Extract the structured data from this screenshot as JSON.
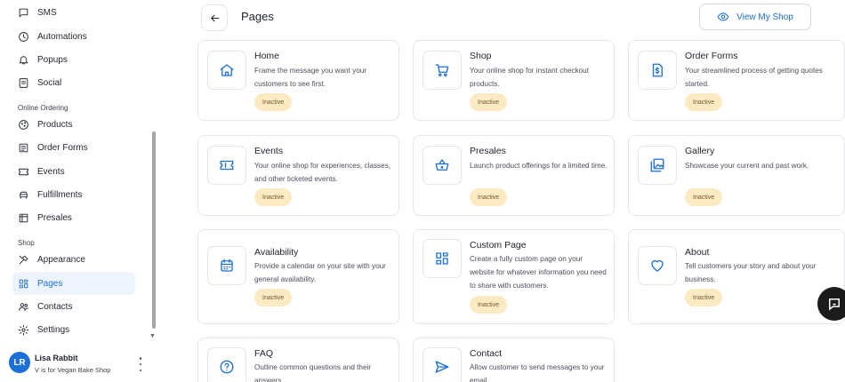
{
  "sidebar": {
    "items": [
      {
        "label": "SMS",
        "icon": "message-icon"
      },
      {
        "label": "Automations",
        "icon": "automation-icon"
      },
      {
        "label": "Popups",
        "icon": "bell-icon"
      },
      {
        "label": "Social",
        "icon": "social-icon"
      },
      {
        "label": "Products",
        "icon": "cookie-icon"
      },
      {
        "label": "Order Forms",
        "icon": "order-forms-icon"
      },
      {
        "label": "Events",
        "icon": "ticket-icon"
      },
      {
        "label": "Fulfillments",
        "icon": "car-icon"
      },
      {
        "label": "Presales",
        "icon": "presales-icon"
      },
      {
        "label": "Appearance",
        "icon": "tools-icon"
      },
      {
        "label": "Pages",
        "icon": "grid-icon"
      },
      {
        "label": "Contacts",
        "icon": "contacts-icon"
      },
      {
        "label": "Settings",
        "icon": "gear-icon"
      }
    ],
    "sections": {
      "online_ordering": "Online Ordering",
      "shop": "Shop"
    },
    "active_item": "Pages"
  },
  "user": {
    "initials": "LR",
    "name": "Lisa Rabbit",
    "shop": "V is for Vegan Bake Shop"
  },
  "header": {
    "title": "Pages",
    "view_shop_label": "View My Shop"
  },
  "cards": [
    {
      "title": "Home",
      "description": "Frame the message you want your customers to see first.",
      "status": "Inactive",
      "icon": "home-icon"
    },
    {
      "title": "Shop",
      "description": "Your online shop for instant checkout products.",
      "status": "Inactive",
      "icon": "cart-icon"
    },
    {
      "title": "Order Forms",
      "description": "Your streamlined process of getting quotes started.",
      "status": "Inactive",
      "icon": "document-dollar-icon"
    },
    {
      "title": "Events",
      "description": "Your online shop for experiences, classes, and other ticketed events.",
      "status": "Inactive",
      "icon": "ticket-icon"
    },
    {
      "title": "Presales",
      "description": "Launch product offerings for a limited time.",
      "status": "Inactive",
      "icon": "basket-icon"
    },
    {
      "title": "Gallery",
      "description": "Showcase your current and past work.",
      "status": "Inactive",
      "icon": "gallery-icon"
    },
    {
      "title": "Availability",
      "description": "Provide a calendar on your site with your general availability.",
      "status": "Inactive",
      "icon": "calendar-icon"
    },
    {
      "title": "Custom Page",
      "description": "Create a fully custom page on your website for whatever information you need to share with customers.",
      "status": "Inactive",
      "icon": "dashboard-icon"
    },
    {
      "title": "About",
      "description": "Tell customers your story and about your business.",
      "status": "Inactive",
      "icon": "heart-icon"
    },
    {
      "title": "FAQ",
      "description": "Outline common questions and their answers.",
      "icon": "question-icon"
    },
    {
      "title": "Contact",
      "description": "Allow customer to send messages to your email.",
      "icon": "send-icon"
    }
  ],
  "colors": {
    "accent": "#1c6fd8",
    "badge_bg": "#fcebc2",
    "active_nav_bg": "#eef4fd"
  }
}
